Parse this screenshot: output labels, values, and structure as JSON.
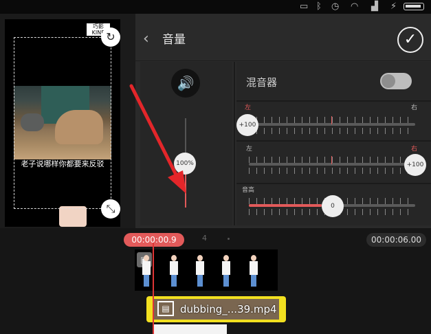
{
  "status_bar": {
    "icons": [
      "notification-icon",
      "bluetooth-icon",
      "alarm-icon",
      "wifi-icon",
      "signal-icon",
      "charging-icon",
      "battery-icon"
    ]
  },
  "preview": {
    "subtitle": "老子说哪样你都要来反驳",
    "watermark": "巧影 KINEMASTER"
  },
  "panel": {
    "title": "音量",
    "back_icon": "chevron-left-icon",
    "confirm_icon": "checkmark-icon",
    "master_volume": {
      "value": 100,
      "label": "100%"
    },
    "mixer": {
      "label": "混音器",
      "enabled": false
    },
    "pan_left": {
      "left_label": "左",
      "right_label": "右",
      "knob_label": "+100",
      "value": -100
    },
    "pan_right": {
      "left_label": "左",
      "right_label": "右",
      "knob_label": "+100",
      "value": 100
    },
    "pitch": {
      "label": "音高",
      "knob_label": "0",
      "value": 0
    }
  },
  "timeline": {
    "current_time": "00:00:00.9",
    "total_time": "00:00:06.00",
    "marker": "4",
    "audio_clip_label": "dubbing_...39.mp4"
  },
  "colors": {
    "accent": "#e25a5a",
    "audio_clip": "#f2e020",
    "panel_bg": "#2a2a2a"
  }
}
